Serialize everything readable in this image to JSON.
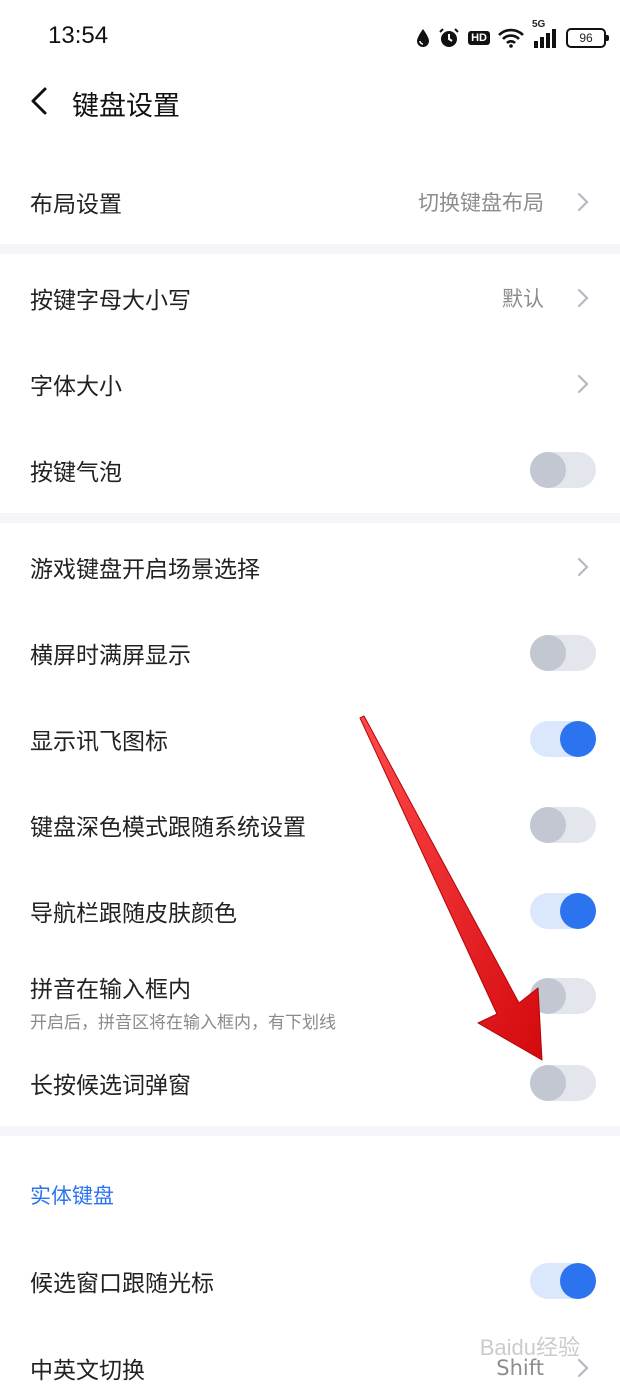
{
  "status_bar": {
    "time": "13:54",
    "hd_badge": "HD",
    "network": "5G",
    "battery": "96",
    "icons": [
      "water-drop-icon",
      "alarm-icon",
      "hd-icon",
      "wifi-icon",
      "signal-5g-icon",
      "battery-icon"
    ]
  },
  "header": {
    "title": "键盘设置",
    "back_icon": "chevron-left-icon"
  },
  "rows": {
    "layout": {
      "label": "布局设置",
      "value": "切换键盘布局"
    },
    "key_case": {
      "label": "按键字母大小写",
      "value": "默认"
    },
    "font_size": {
      "label": "字体大小"
    },
    "key_bubble": {
      "label": "按键气泡",
      "enabled": false
    },
    "game_keyboard": {
      "label": "游戏键盘开启场景选择"
    },
    "landscape_fullscreen": {
      "label": "横屏时满屏显示",
      "enabled": false
    },
    "show_xunfei_icon": {
      "label": "显示讯飞图标",
      "enabled": true
    },
    "dark_mode_follow": {
      "label": "键盘深色模式跟随系统设置",
      "enabled": false
    },
    "nav_bar_skin": {
      "label": "导航栏跟随皮肤颜色",
      "enabled": true
    },
    "pinyin_inline": {
      "label": "拼音在输入框内",
      "sub": "开启后，拼音区将在输入框内，有下划线",
      "enabled": false
    },
    "long_press_popup": {
      "label": "长按候选词弹窗",
      "enabled": false
    }
  },
  "physical_keyboard": {
    "section_title": "实体键盘",
    "candidate_follow_cursor": {
      "label": "候选窗口跟随光标",
      "enabled": true
    },
    "cn_en_switch": {
      "label": "中英文切换",
      "value": "Shift"
    }
  },
  "watermark": "Baidu经验",
  "colors": {
    "accent": "#2c73f0",
    "toggle_on_track": "#dbe7fd",
    "toggle_off_track": "#e3e6ec",
    "toggle_off_knob": "#c2c7d2",
    "divider": "#f3f5f9",
    "annotation_arrow": "#e8161b"
  }
}
